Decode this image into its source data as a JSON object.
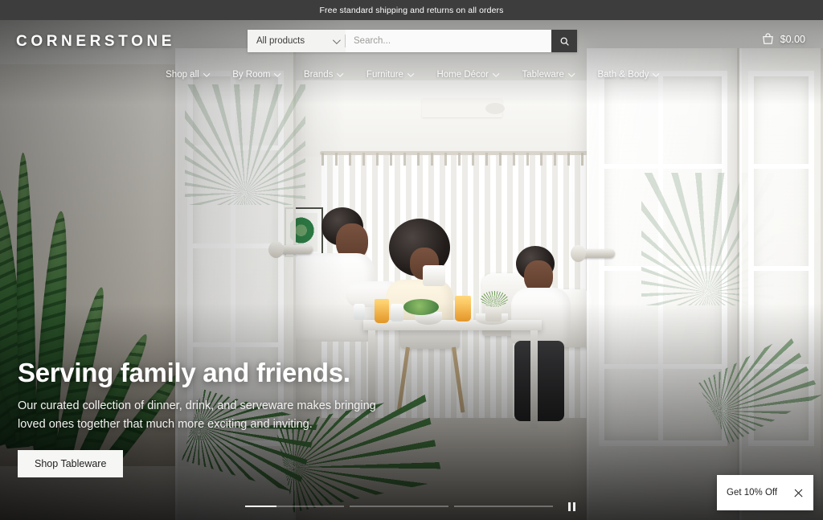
{
  "promo": {
    "text": "Free standard shipping and returns on all orders"
  },
  "header": {
    "logo": "CORNERSTONE",
    "search": {
      "category_selected": "All products",
      "placeholder": "Search...",
      "search_icon": "search-icon",
      "chevron_icon": "chevron-down-icon"
    },
    "cart": {
      "icon": "shopping-bag-icon",
      "total": "$0.00"
    }
  },
  "nav": {
    "items": [
      {
        "label": "Shop all",
        "chevron": "chevron-down-icon"
      },
      {
        "label": "By Room",
        "chevron": "chevron-down-icon"
      },
      {
        "label": "Brands",
        "chevron": "chevron-down-icon"
      },
      {
        "label": "Furniture",
        "chevron": "chevron-down-icon"
      },
      {
        "label": "Home Décor",
        "chevron": "chevron-down-icon"
      },
      {
        "label": "Tableware",
        "chevron": "chevron-down-icon"
      },
      {
        "label": "Bath & Body",
        "chevron": "chevron-down-icon"
      }
    ]
  },
  "hero": {
    "title": "Serving family and friends.",
    "subtitle": "Our curated collection of dinner, drink, and serveware makes bringing loved ones together that much more exciting and inviting.",
    "cta_label": "Shop Tableware"
  },
  "carousel": {
    "slides": [
      {
        "index": 1,
        "progress": 32,
        "active": true
      },
      {
        "index": 2,
        "progress": 0,
        "active": false
      },
      {
        "index": 3,
        "progress": 0,
        "active": false
      }
    ],
    "playback_icon": "pause-icon",
    "playback_state": "playing"
  },
  "popup": {
    "label": "Get 10% Off",
    "close_icon": "close-icon"
  },
  "colors": {
    "promo_bar": "#3d3d3d",
    "search_button": "#3b3b3b",
    "cta_background": "#f6f6f4",
    "popup_background": "#ffffff",
    "text_on_hero": "#ffffff"
  }
}
